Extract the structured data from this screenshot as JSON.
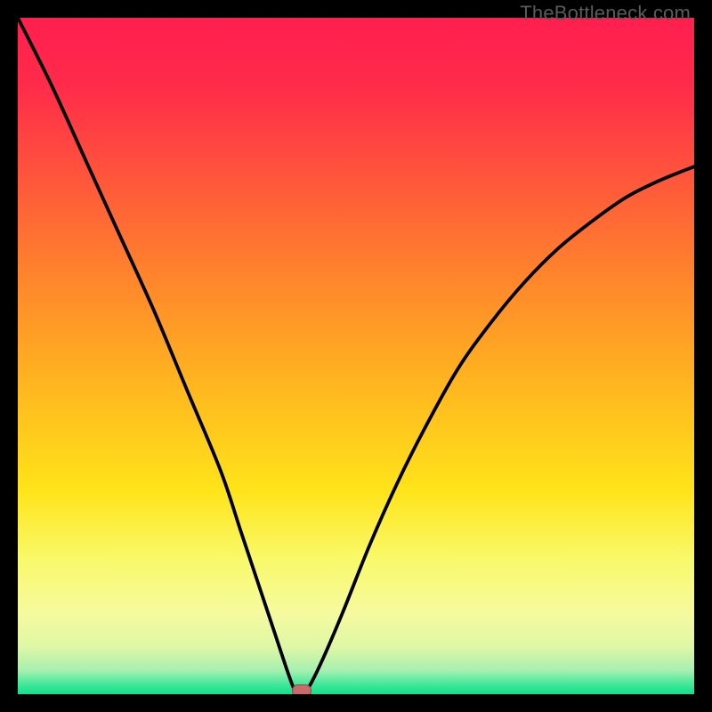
{
  "watermark": {
    "text": "TheBottleneck.com"
  },
  "colors": {
    "frame": "#000000",
    "gradient_stops": [
      {
        "offset": 0.0,
        "color": "#ff1f4f"
      },
      {
        "offset": 0.1,
        "color": "#ff2b4a"
      },
      {
        "offset": 0.25,
        "color": "#ff5a3a"
      },
      {
        "offset": 0.4,
        "color": "#ff8a2a"
      },
      {
        "offset": 0.55,
        "color": "#ffb81f"
      },
      {
        "offset": 0.7,
        "color": "#ffe41a"
      },
      {
        "offset": 0.8,
        "color": "#f9f96a"
      },
      {
        "offset": 0.88,
        "color": "#f6fa9f"
      },
      {
        "offset": 0.93,
        "color": "#dff7a6"
      },
      {
        "offset": 0.965,
        "color": "#a6f0b0"
      },
      {
        "offset": 0.985,
        "color": "#43e89a"
      },
      {
        "offset": 1.0,
        "color": "#11df8a"
      }
    ],
    "curve": "#000000",
    "marker_fill": "#c96a6b",
    "marker_stroke": "#8e4a4b"
  },
  "chart_data": {
    "type": "line",
    "title": "",
    "xlabel": "",
    "ylabel": "",
    "xlim": [
      0,
      100
    ],
    "ylim": [
      0,
      100
    ],
    "grid": false,
    "legend": false,
    "series": [
      {
        "name": "bottleneck-curve",
        "x": [
          0,
          5,
          10,
          15,
          20,
          25,
          30,
          33,
          36,
          38,
          40,
          41,
          42,
          43,
          45,
          48,
          52,
          56,
          60,
          65,
          70,
          75,
          80,
          85,
          90,
          95,
          100
        ],
        "y": [
          100,
          90,
          79,
          68,
          57,
          45,
          33,
          24,
          15,
          9,
          3,
          0.5,
          0,
          1,
          5,
          12,
          22,
          31,
          39,
          48,
          55,
          61,
          66,
          70,
          73.5,
          76,
          78
        ]
      }
    ],
    "markers": [
      {
        "name": "optimal-point",
        "x": 42,
        "y": 0
      }
    ]
  }
}
